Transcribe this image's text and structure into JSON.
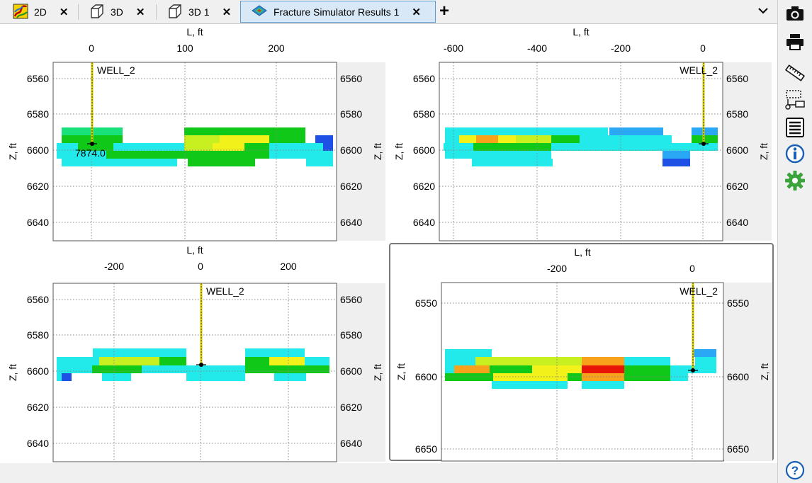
{
  "tabs": [
    {
      "label": "2D",
      "icon": "2d-map-icon",
      "active": false
    },
    {
      "label": "3D",
      "icon": "3d-cube-icon",
      "active": false
    },
    {
      "label": "3D 1",
      "icon": "3d-cube-icon",
      "active": false
    },
    {
      "label": "Fracture Simulator Results 1",
      "icon": "fracture-surface-icon",
      "active": true
    }
  ],
  "toolbar": [
    "camera-icon",
    "printer-icon",
    "ruler-icon",
    "selection-tool-icon",
    "list-icon",
    "info-icon",
    "gear-icon",
    "help-icon"
  ],
  "colors": {
    "accent": "#5a9bd5",
    "well": "#d8d000",
    "settings": "#3aa33a"
  },
  "panels": [
    {
      "xlabel": "L, ft",
      "ylabel": "Z, ft",
      "x_ticks": [
        "0",
        "100",
        "200"
      ],
      "y_ticks_left": [
        "6560",
        "6580",
        "6600",
        "6620",
        "6640"
      ],
      "y_ticks_right": [
        "6560",
        "6580",
        "6600",
        "6620",
        "6640"
      ],
      "well_label": "WELL_2",
      "marker_label": "7874.0",
      "selected": false
    },
    {
      "xlabel": "L, ft",
      "ylabel": "Z, ft",
      "x_ticks": [
        "-600",
        "-400",
        "-200",
        "0"
      ],
      "y_ticks_left": [
        "6560",
        "6580",
        "6600",
        "6620",
        "6640"
      ],
      "y_ticks_right": [
        "6560",
        "6580",
        "6600",
        "6620",
        "6640"
      ],
      "well_label": "WELL_2",
      "marker_label": "",
      "selected": false
    },
    {
      "xlabel": "L, ft",
      "ylabel": "Z, ft",
      "x_ticks": [
        "-200",
        "0",
        "200"
      ],
      "y_ticks_left": [
        "6560",
        "6580",
        "6600",
        "6620",
        "6640"
      ],
      "y_ticks_right": [
        "6560",
        "6580",
        "6600",
        "6620",
        "6640"
      ],
      "well_label": "WELL_2",
      "marker_label": "",
      "selected": false
    },
    {
      "xlabel": "L, ft",
      "ylabel": "Z, ft",
      "x_ticks": [
        "-200",
        "0"
      ],
      "y_ticks_left": [
        "6550",
        "6600",
        "6650"
      ],
      "y_ticks_right": [
        "6550",
        "6600",
        "6650"
      ],
      "well_label": "WELL_2",
      "marker_label": "",
      "selected": true
    }
  ]
}
